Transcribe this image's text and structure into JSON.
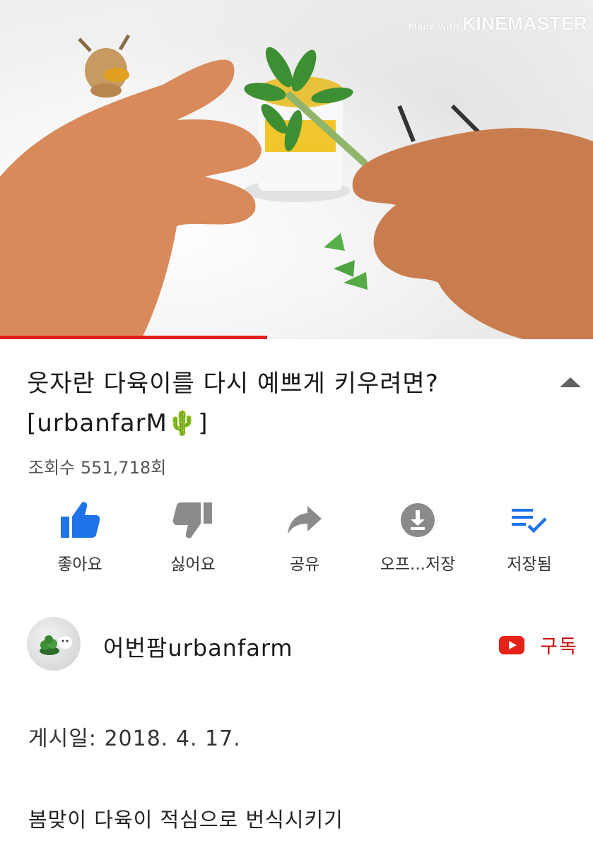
{
  "video": {
    "watermark_prefix": "Made with",
    "watermark_brand": "KINEMASTER",
    "progress_fraction": 0.45,
    "progress_color": "#e1201b"
  },
  "title": {
    "line1": "웃자란 다육이를 다시 예쁘게 키우려면?",
    "line2": "[urbanfarM🌵]",
    "collapse_icon": "chevron-up-icon"
  },
  "views": "조회수 551,718회",
  "actions": [
    {
      "label": "좋아요",
      "icon": "thumbs-up-icon",
      "color": "#1e73e8"
    },
    {
      "label": "싫어요",
      "icon": "thumbs-down-icon",
      "color": "#8a8a8a"
    },
    {
      "label": "공유",
      "icon": "share-icon",
      "color": "#8a8a8a"
    },
    {
      "label": "오프...저장",
      "icon": "download-icon",
      "color": "#8a8a8a"
    },
    {
      "label": "저장됨",
      "icon": "playlist-saved-icon",
      "color": "#1e73e8"
    }
  ],
  "channel": {
    "name": "어번팜urbanfarm",
    "subscribe_label": "구독",
    "subscribe_color": "#cc0000"
  },
  "description": {
    "published": "게시일: 2018. 4. 17.",
    "text": "봄맞이 다육이 적심으로 번식시키기"
  }
}
